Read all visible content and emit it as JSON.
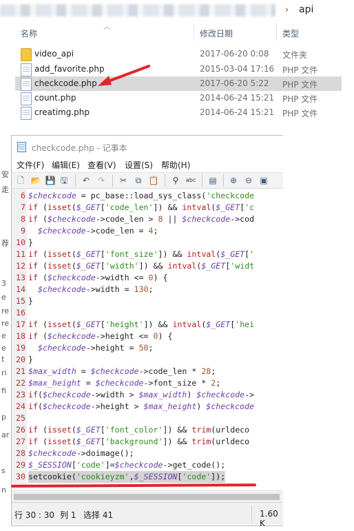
{
  "explorer": {
    "breadcrumb_sep": "›",
    "breadcrumb_current": "api",
    "columns": {
      "name": "名称",
      "date": "修改日期",
      "type": "类型"
    },
    "files": [
      {
        "icon": "folder-icon",
        "name": "video_api",
        "date": "2017-06-20 0:08",
        "type": "文件夹"
      },
      {
        "icon": "php-file-icon",
        "name": "add_favorite.php",
        "date": "2015-03-04 17:16",
        "type": "PHP 文件"
      },
      {
        "icon": "php-file-icon",
        "name": "checkcode.php",
        "date": "2017-06-20 5:22",
        "type": "PHP 文件",
        "selected": true
      },
      {
        "icon": "php-file-icon",
        "name": "count.php",
        "date": "2014-06-24 15:21",
        "type": "PHP 文件"
      },
      {
        "icon": "php-file-icon",
        "name": "creatimg.php",
        "date": "2014-06-24 15:21",
        "type": "PHP 文件"
      }
    ]
  },
  "left_strip": [
    "安",
    "走",
    "荐",
    "3",
    "e",
    "re",
    "re",
    "e",
    "e",
    "t",
    "ri",
    "fi",
    "p",
    "ar",
    "s",
    "n"
  ],
  "notepad": {
    "title": "checkcode.php - 记事本",
    "menu": [
      "文件(F)",
      "编辑(E)",
      "查看(V)",
      "设置(S)",
      "帮助(H)"
    ],
    "lines": [
      {
        "n": "6",
        "t": "$checkcode = pc_base::load_sys_class('checkcode"
      },
      {
        "n": "7",
        "t": "if (isset($_GET['code_len']) && intval($_GET['c"
      },
      {
        "n": "8",
        "t": "if ($checkcode->code_len > 8 || $checkcode->cod"
      },
      {
        "n": "9",
        "t": "  $checkcode->code_len = 4;"
      },
      {
        "n": "10",
        "t": "}"
      },
      {
        "n": "11",
        "t": "if (isset($_GET['font_size']) && intval($_GET['"
      },
      {
        "n": "12",
        "t": "if (isset($_GET['width']) && intval($_GET['widt"
      },
      {
        "n": "13",
        "t": "if ($checkcode->width <= 0) {"
      },
      {
        "n": "14",
        "t": "  $checkcode->width = 130;"
      },
      {
        "n": "15",
        "t": "}"
      },
      {
        "n": "16",
        "t": ""
      },
      {
        "n": "17",
        "t": "if (isset($_GET['height']) && intval($_GET['hei"
      },
      {
        "n": "18",
        "t": "if ($checkcode->height <= 0) {"
      },
      {
        "n": "19",
        "t": "  $checkcode->height = 50;"
      },
      {
        "n": "20",
        "t": "}"
      },
      {
        "n": "21",
        "t": "$max_width = $checkcode->code_len * 28;"
      },
      {
        "n": "22",
        "t": "$max_height = $checkcode->font_size * 2;"
      },
      {
        "n": "23",
        "t": "if($checkcode->width > $max_width) $checkcode->"
      },
      {
        "n": "24",
        "t": "if($checkcode->height > $max_height) $checkcode"
      },
      {
        "n": "25",
        "t": ""
      },
      {
        "n": "26",
        "t": "if (isset($_GET['font_color']) && trim(urldeco"
      },
      {
        "n": "27",
        "t": "if (isset($_GET['background']) && trim(urldeco"
      },
      {
        "n": "28",
        "t": "$checkcode->doimage();"
      },
      {
        "n": "29",
        "t": "$_SESSION['code']=$checkcode->get_code();"
      },
      {
        "n": "30",
        "t": "setcookie('cookieyzm',$_SESSION['code']);",
        "highlight": true
      }
    ],
    "status": {
      "position": "行 30 : 30",
      "column": "列 1",
      "selection": "选择 41",
      "size": "1.60 K"
    }
  }
}
